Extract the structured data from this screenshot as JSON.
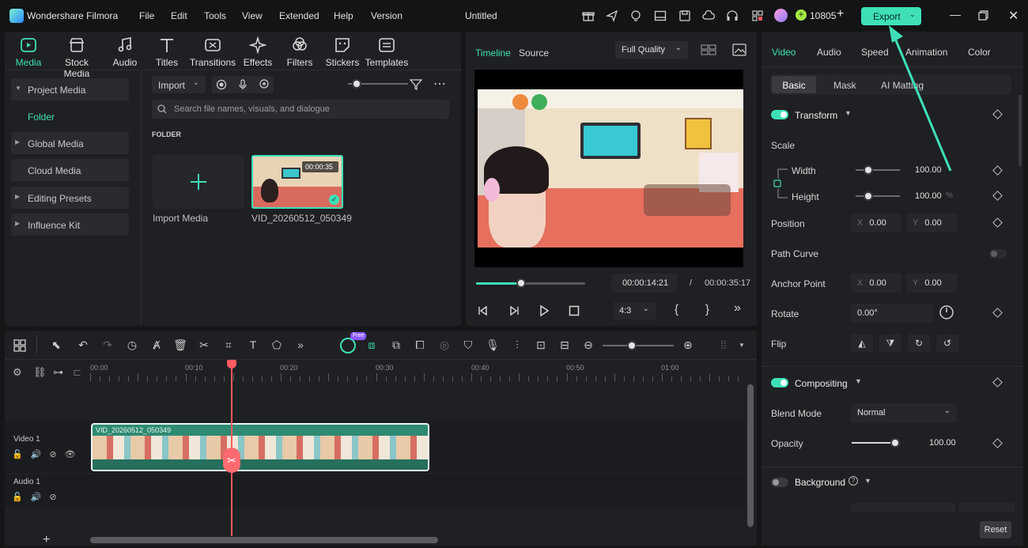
{
  "app": {
    "name": "Wondershare Filmora",
    "project_title": "Untitled",
    "credits": "10805"
  },
  "menu": [
    "File",
    "Edit",
    "Tools",
    "View",
    "Extended",
    "Help",
    "Version"
  ],
  "export_label": "Export",
  "tool_tabs": [
    "Media",
    "Stock Media",
    "Audio",
    "Titles",
    "Transitions",
    "Effects",
    "Filters",
    "Stickers",
    "Templates"
  ],
  "sidebar": {
    "items": [
      "Project Media",
      "Folder",
      "Global Media",
      "Cloud Media",
      "Editing Presets",
      "Influence Kit"
    ]
  },
  "media": {
    "import_label": "Import",
    "search_placeholder": "Search file names, visuals, and dialogue",
    "folder_label": "FOLDER",
    "import_media_label": "Import Media",
    "clip_name": "VID_20260512_050349",
    "clip_duration": "00:00:35"
  },
  "player": {
    "tab_timeline": "Timeline",
    "tab_source": "Source",
    "quality": "Full Quality",
    "current_time": "00:00:14:21",
    "separator": "/",
    "total_time": "00:00:35:17",
    "aspect": "4:3",
    "progress": 0.41
  },
  "props": {
    "tabs": [
      "Video",
      "Audio",
      "Speed",
      "Animation",
      "Color"
    ],
    "subtabs": [
      "Basic",
      "Mask",
      "AI Matting"
    ],
    "transform_label": "Transform",
    "scale_label": "Scale",
    "width_label": "Width",
    "width_value": "100.00",
    "height_label": "Height",
    "height_value": "100.00",
    "height_unit": "%",
    "position_label": "Position",
    "pos_x_label": "X",
    "pos_x": "0.00",
    "pos_y_label": "Y",
    "pos_y": "0.00",
    "path_curve_label": "Path Curve",
    "anchor_label": "Anchor Point",
    "anchor_x": "0.00",
    "anchor_y": "0.00",
    "rotate_label": "Rotate",
    "rotate_value": "0.00°",
    "flip_label": "Flip",
    "compositing_label": "Compositing",
    "blend_label": "Blend Mode",
    "blend_value": "Normal",
    "opacity_label": "Opacity",
    "opacity_value": "100.00",
    "background_label": "Background",
    "reset_label": "Reset"
  },
  "timeline": {
    "ruler": [
      "00:00",
      "00:10",
      "00:20",
      "00:30",
      "00:40",
      "00:50",
      "01:00"
    ],
    "video_track": "Video 1",
    "audio_track": "Audio 1",
    "clip_label": "VID_20260512_050349",
    "ai_badge": "Free"
  },
  "colors": {
    "accent": "#3ee0b8",
    "playhead": "#ff5a5f",
    "clip": "#2e8a72"
  }
}
